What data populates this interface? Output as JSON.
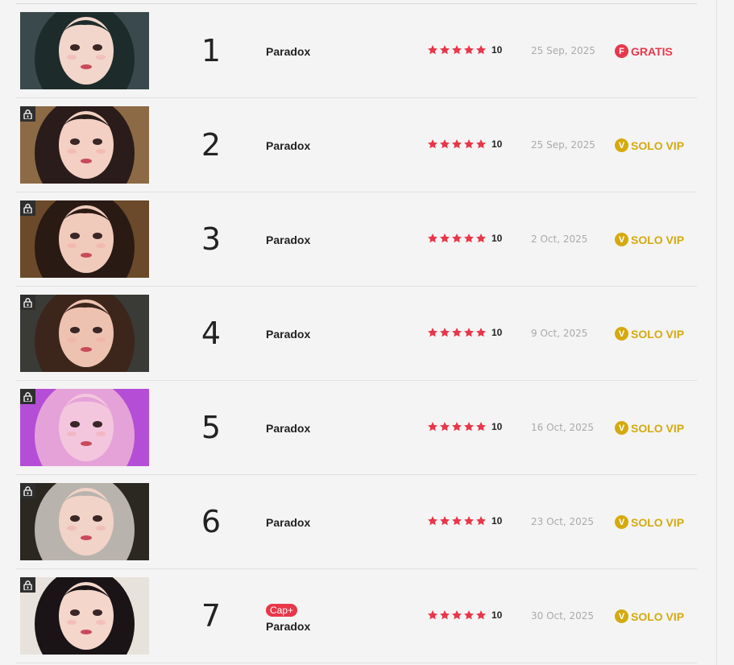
{
  "chapters": [
    {
      "number": "1",
      "title": "Paradox",
      "rating": "10",
      "date": "25 Sep, 2025",
      "status": "GRATIS",
      "status_type": "free",
      "status_letter": "F",
      "locked": false,
      "badge": "",
      "art": {
        "bg": "#3a4a4c",
        "hair": "#1d2c2a",
        "skin": "#f2d6cc"
      }
    },
    {
      "number": "2",
      "title": "Paradox",
      "rating": "10",
      "date": "25 Sep, 2025",
      "status": "SOLO VIP",
      "status_type": "vip",
      "status_letter": "V",
      "locked": true,
      "badge": "",
      "art": {
        "bg": "#8c6a45",
        "hair": "#2a1c1a",
        "skin": "#f3d0c3"
      }
    },
    {
      "number": "3",
      "title": "Paradox",
      "rating": "10",
      "date": "2 Oct, 2025",
      "status": "SOLO VIP",
      "status_type": "vip",
      "status_letter": "V",
      "locked": true,
      "badge": "",
      "art": {
        "bg": "#6a4a2a",
        "hair": "#2a1a14",
        "skin": "#f0cbbb"
      }
    },
    {
      "number": "4",
      "title": "Paradox",
      "rating": "10",
      "date": "9 Oct, 2025",
      "status": "SOLO VIP",
      "status_type": "vip",
      "status_letter": "V",
      "locked": true,
      "badge": "",
      "art": {
        "bg": "#3a3a36",
        "hair": "#3c261c",
        "skin": "#eec2b0"
      }
    },
    {
      "number": "5",
      "title": "Paradox",
      "rating": "10",
      "date": "16 Oct, 2025",
      "status": "SOLO VIP",
      "status_type": "vip",
      "status_letter": "V",
      "locked": true,
      "badge": "",
      "art": {
        "bg": "#b44ed6",
        "hair": "#e5a2d8",
        "skin": "#f3c6de"
      }
    },
    {
      "number": "6",
      "title": "Paradox",
      "rating": "10",
      "date": "23 Oct, 2025",
      "status": "SOLO VIP",
      "status_type": "vip",
      "status_letter": "V",
      "locked": true,
      "badge": "",
      "art": {
        "bg": "#2b2822",
        "hair": "#b9b3ad",
        "skin": "#f1d3c7"
      }
    },
    {
      "number": "7",
      "title": "Paradox",
      "rating": "10",
      "date": "30 Oct, 2025",
      "status": "SOLO VIP",
      "status_type": "vip",
      "status_letter": "V",
      "locked": true,
      "badge": "Cap+",
      "art": {
        "bg": "#e8e2dc",
        "hair": "#1a1416",
        "skin": "#f4d6cb"
      }
    }
  ],
  "icons": {
    "lock": "lock-icon",
    "star": "star-icon"
  },
  "colors": {
    "star": "#e8374a",
    "free": "#e8374a",
    "vip": "#d4aa0e"
  }
}
